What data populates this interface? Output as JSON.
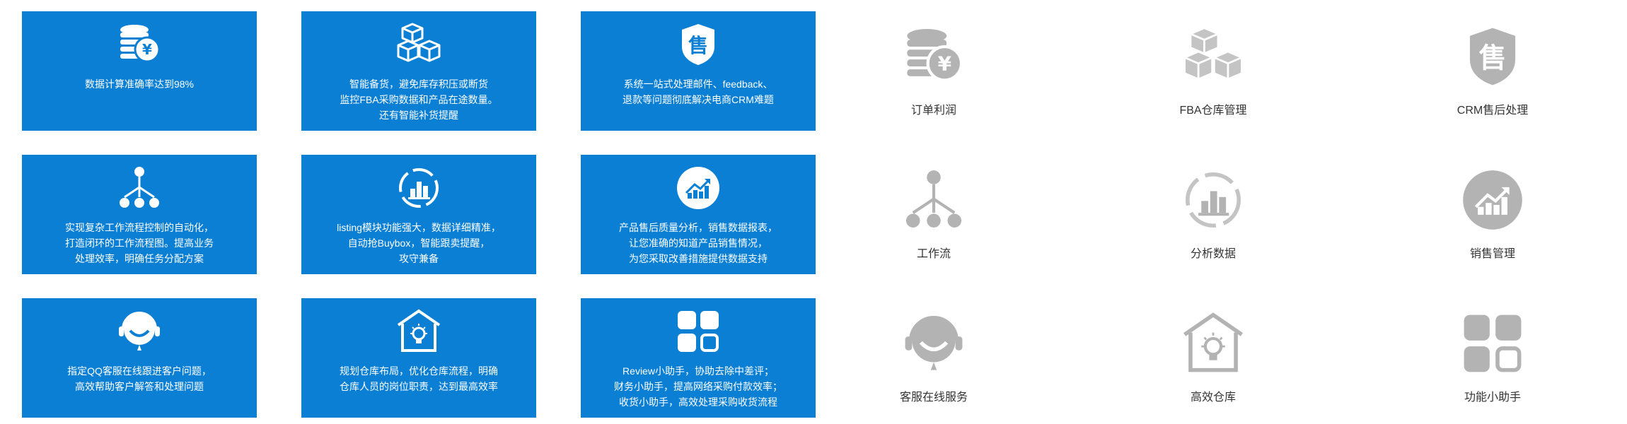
{
  "colors": {
    "card_bg": "#0a7fd4",
    "card_text": "#ffffff",
    "icon_gray": "#b3b3b3",
    "label_text": "#333333"
  },
  "cards": [
    {
      "icon": "coins-yen-icon",
      "text": "数据计算准确率达到98%"
    },
    {
      "icon": "boxes-icon",
      "text": "智能备货，避免库存积压或断货\n监控FBA采购数据和产品在途数量。\n还有智能补货提醒"
    },
    {
      "icon": "shield-shou-icon",
      "text": "系统一站式处理邮件、feedback、\n退款等问题彻底解决电商CRM难题"
    },
    {
      "icon": "workflow-tree-icon",
      "text": "实现复杂工作流程控制的自动化，\n打造闭环的工作流程图。提高业务\n处理效率，明确任务分配方案"
    },
    {
      "icon": "analysis-chart-icon",
      "text": "listing模块功能强大，数据详细精准，\n自动抢Buybox，智能跟卖提醒，\n攻守兼备"
    },
    {
      "icon": "trend-chart-icon",
      "text": "产品售后质量分析，销售数据报表，\n让您准确的知道产品销售情况，\n为您采取改善措施提供数据支持"
    },
    {
      "icon": "headset-smile-icon",
      "text": "指定QQ客服在线跟进客户问题，\n高效帮助客户解答和处理问题"
    },
    {
      "icon": "warehouse-bulb-icon",
      "text": "规划仓库布局，优化仓库流程，明确\n仓库人员的岗位职责，达到最高效率"
    },
    {
      "icon": "app-grid-icon",
      "text": "Review小助手，协助去除中差评；\n财务小助手，提高网络采购付款效率；\n收货小助手，高效处理采购收货流程"
    }
  ],
  "features": [
    {
      "icon": "coins-yen-icon",
      "label": "订单利润"
    },
    {
      "icon": "boxes-icon",
      "label": "FBA仓库管理"
    },
    {
      "icon": "shield-shou-icon",
      "label": "CRM售后处理"
    },
    {
      "icon": "workflow-tree-icon",
      "label": "工作流"
    },
    {
      "icon": "analysis-chart-icon",
      "label": "分析数据"
    },
    {
      "icon": "trend-chart-icon",
      "label": "销售管理"
    },
    {
      "icon": "headset-smile-icon",
      "label": "客服在线服务"
    },
    {
      "icon": "warehouse-bulb-icon",
      "label": "高效仓库"
    },
    {
      "icon": "app-grid-icon",
      "label": "功能小助手"
    }
  ]
}
